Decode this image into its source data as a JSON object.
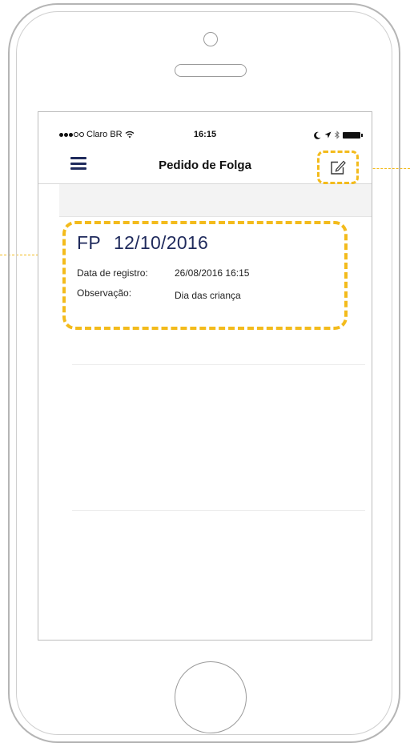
{
  "status_bar": {
    "carrier": "Claro BR",
    "time": "16:15"
  },
  "nav": {
    "title": "Pedido de Folga"
  },
  "record": {
    "code": "FP",
    "date": "12/10/2016",
    "fields": [
      {
        "label": "Data de registro:",
        "value": "26/08/2016 16:15"
      },
      {
        "label": "Observação:",
        "value": "Dia das criança"
      }
    ]
  },
  "colors": {
    "accent_dashed": "#f3bb1c",
    "nav_icon": "#1f2a5c",
    "title_text": "#1f2a5c"
  }
}
